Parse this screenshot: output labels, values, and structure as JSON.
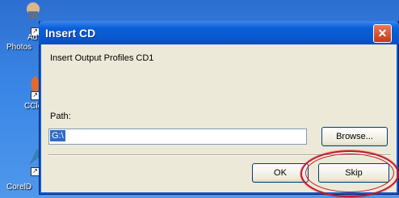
{
  "desktop": {
    "icons": [
      {
        "label_line1": "Ad",
        "label_line2": "Photos"
      },
      {
        "label": "CCle"
      },
      {
        "label": "CorelD"
      }
    ]
  },
  "dialog": {
    "title": "Insert CD",
    "message": "Insert Output Profiles CD1",
    "path_label": "Path:",
    "path_value": "G:\\",
    "browse_label": "Browse...",
    "ok_label": "OK",
    "skip_label": "Skip",
    "close_glyph": "✕"
  },
  "annotation": {
    "color": "#c2182a"
  }
}
